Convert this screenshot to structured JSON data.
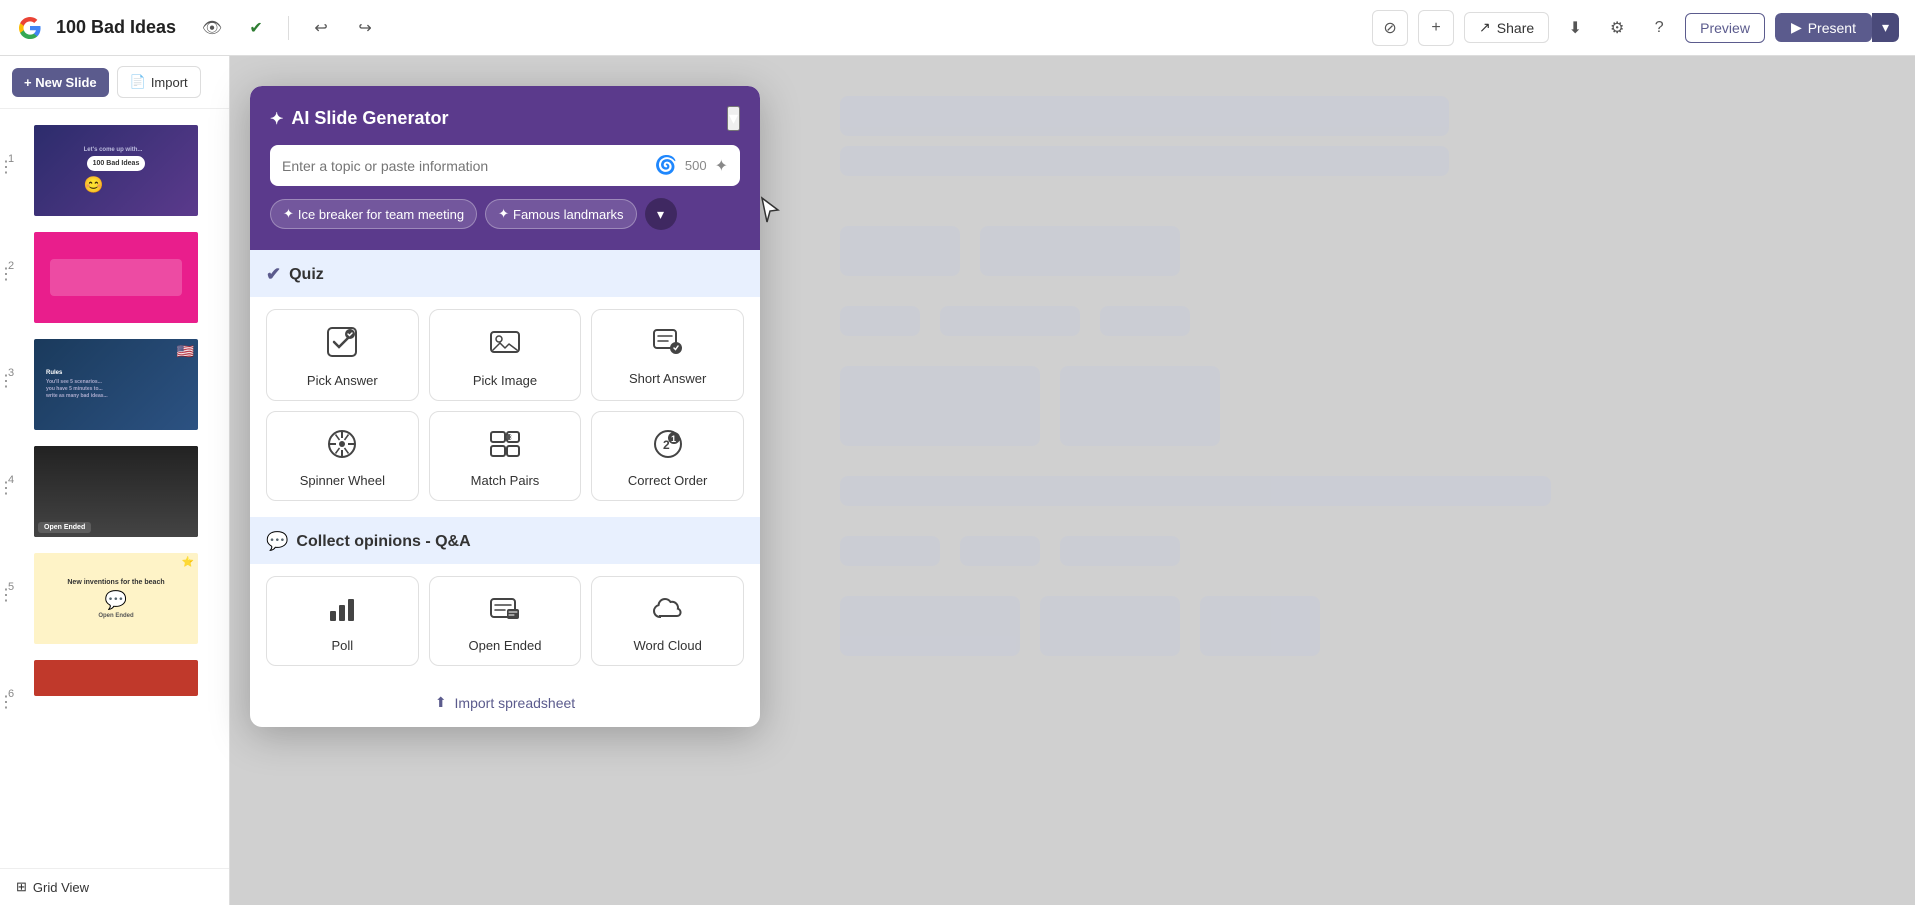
{
  "app": {
    "title": "100 Bad Ideas",
    "logo_color": "#EA4335"
  },
  "topbar": {
    "title": "100 Bad Ideas",
    "share_label": "Share",
    "preview_label": "Preview",
    "present_label": "Present"
  },
  "sidebar": {
    "new_slide_label": "+ New Slide",
    "import_label": "Import",
    "grid_view_label": "Grid View",
    "slides": [
      {
        "number": "1",
        "type": "title",
        "active": false
      },
      {
        "number": "2",
        "type": "pink",
        "active": false
      },
      {
        "number": "3",
        "type": "rules",
        "active": false
      },
      {
        "number": "4",
        "type": "dark",
        "active": false
      },
      {
        "number": "5",
        "type": "yellow",
        "active": false,
        "label": "New inventions for the beach",
        "sublabel": "Open Ended"
      },
      {
        "number": "6",
        "type": "red",
        "active": false
      }
    ]
  },
  "ai_panel": {
    "title": "AI Slide Generator",
    "input_placeholder": "Enter a topic or paste information",
    "char_limit": "500",
    "suggestions": [
      {
        "label": "Ice breaker for team meeting"
      },
      {
        "label": "Famous landmarks"
      }
    ],
    "more_label": "▾"
  },
  "quiz_section": {
    "label": "Quiz",
    "items": [
      {
        "id": "pick-answer",
        "icon": "☑",
        "label": "Pick Answer"
      },
      {
        "id": "pick-image",
        "icon": "🖼",
        "label": "Pick Image"
      },
      {
        "id": "short-answer",
        "icon": "📝",
        "label": "Short Answer"
      },
      {
        "id": "spinner-wheel",
        "icon": "⚙",
        "label": "Spinner Wheel"
      },
      {
        "id": "match-pairs",
        "icon": "📋",
        "label": "Match Pairs"
      },
      {
        "id": "correct-order",
        "icon": "🔢",
        "label": "Correct Order"
      }
    ]
  },
  "opinions_section": {
    "label": "Collect opinions - Q&A",
    "items": [
      {
        "id": "poll",
        "icon": "📊",
        "label": "Poll"
      },
      {
        "id": "open-ended",
        "icon": "💬",
        "label": "Open Ended"
      },
      {
        "id": "word-cloud",
        "icon": "☁",
        "label": "Word Cloud"
      }
    ]
  },
  "import": {
    "label": "Import spreadsheet"
  }
}
